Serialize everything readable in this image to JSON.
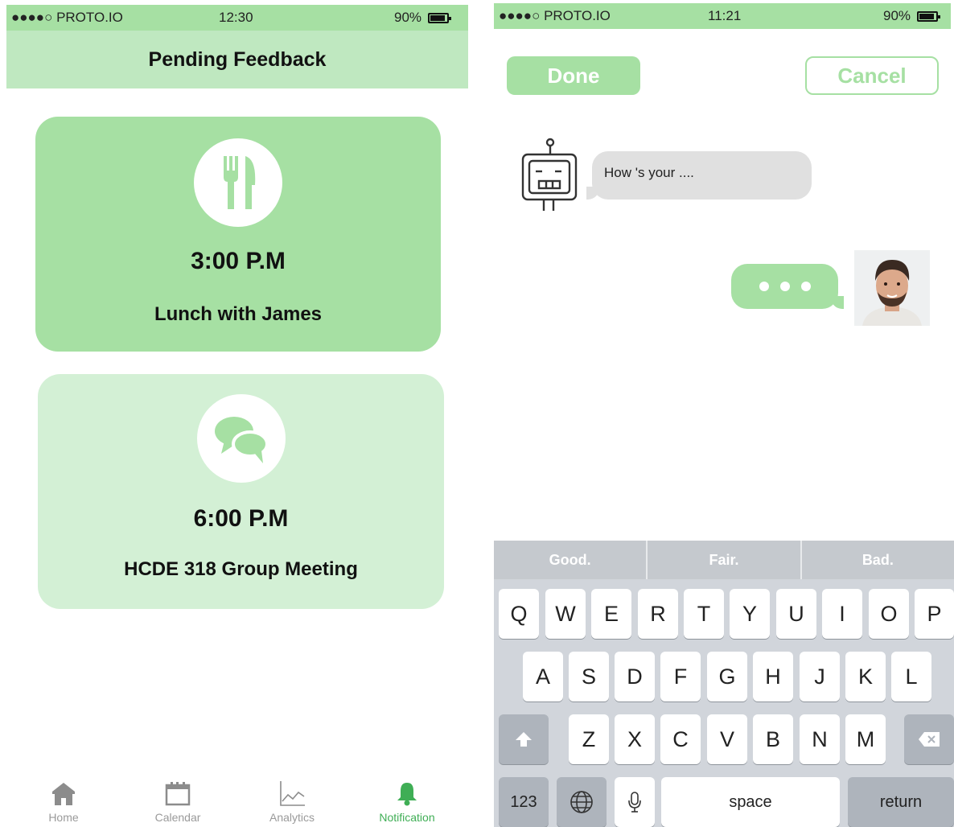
{
  "left_screen": {
    "status_bar": {
      "carrier": "●●●●○ PROTO.IO",
      "time": "12:30",
      "battery": "90%"
    },
    "nav_title": "Pending Feedback",
    "cards": [
      {
        "icon": "fork-knife-icon",
        "time": "3:00 P.M",
        "title": "Lunch with James",
        "color": "#a6e0a3"
      },
      {
        "icon": "chat-bubbles-icon",
        "time": "6:00 P.M",
        "title": "HCDE 318 Group Meeting",
        "color": "#d3f0d5"
      }
    ],
    "tabs": [
      {
        "label": "Home",
        "icon": "home-icon",
        "active": false
      },
      {
        "label": "Calendar",
        "icon": "calendar-icon",
        "active": false
      },
      {
        "label": "Analytics",
        "icon": "analytics-chart-icon",
        "active": false
      },
      {
        "label": "Notification",
        "icon": "bell-icon",
        "active": true
      }
    ],
    "accent_color": "#3fae55"
  },
  "right_screen": {
    "status_bar": {
      "carrier": "●●●●○ PROTO.IO",
      "time": "11:21",
      "battery": "90%"
    },
    "done_label": "Done",
    "cancel_label": "Cancel",
    "bot_message": "How 's your ....",
    "suggestions": [
      "Good.",
      "Fair.",
      "Bad."
    ],
    "keyboard": {
      "row1": [
        "Q",
        "W",
        "E",
        "R",
        "T",
        "Y",
        "U",
        "I",
        "O",
        "P"
      ],
      "row2": [
        "A",
        "S",
        "D",
        "F",
        "G",
        "H",
        "J",
        "K",
        "L"
      ],
      "row3": [
        "Z",
        "X",
        "C",
        "V",
        "B",
        "N",
        "M"
      ],
      "numbers_key": "123",
      "space_key": "space",
      "return_key": "return"
    }
  }
}
